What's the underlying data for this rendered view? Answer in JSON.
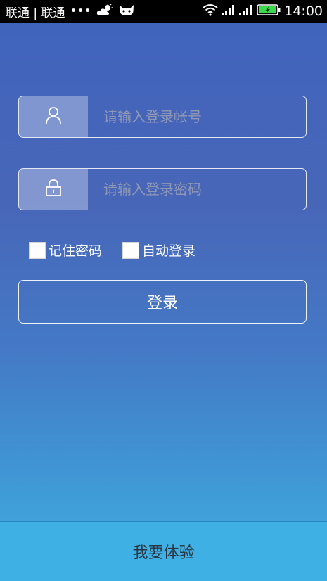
{
  "status_bar": {
    "carrier": "联通 | 联通",
    "dots": "•••",
    "time": "14:00"
  },
  "login_form": {
    "username_placeholder": "请输入登录帐号",
    "username_value": "",
    "password_placeholder": "请输入登录密码",
    "password_value": "",
    "remember_label": "记住密码",
    "remember_checked": false,
    "auto_login_label": "自动登录",
    "auto_login_checked": false,
    "login_button_label": "登录"
  },
  "bottom": {
    "experience_label": "我要体验"
  },
  "colors": {
    "status_bar": "#000000",
    "background_top": "#3f64bd",
    "background_bottom": "#42aee2",
    "bottom_bar": "#3fb0e4",
    "battery": "#3bd94a"
  },
  "icons": [
    "weather-cloud-icon",
    "cat-face-icon",
    "wifi-icon",
    "signal-icon",
    "signal-icon-2",
    "battery-icon",
    "user-icon",
    "lock-icon"
  ]
}
